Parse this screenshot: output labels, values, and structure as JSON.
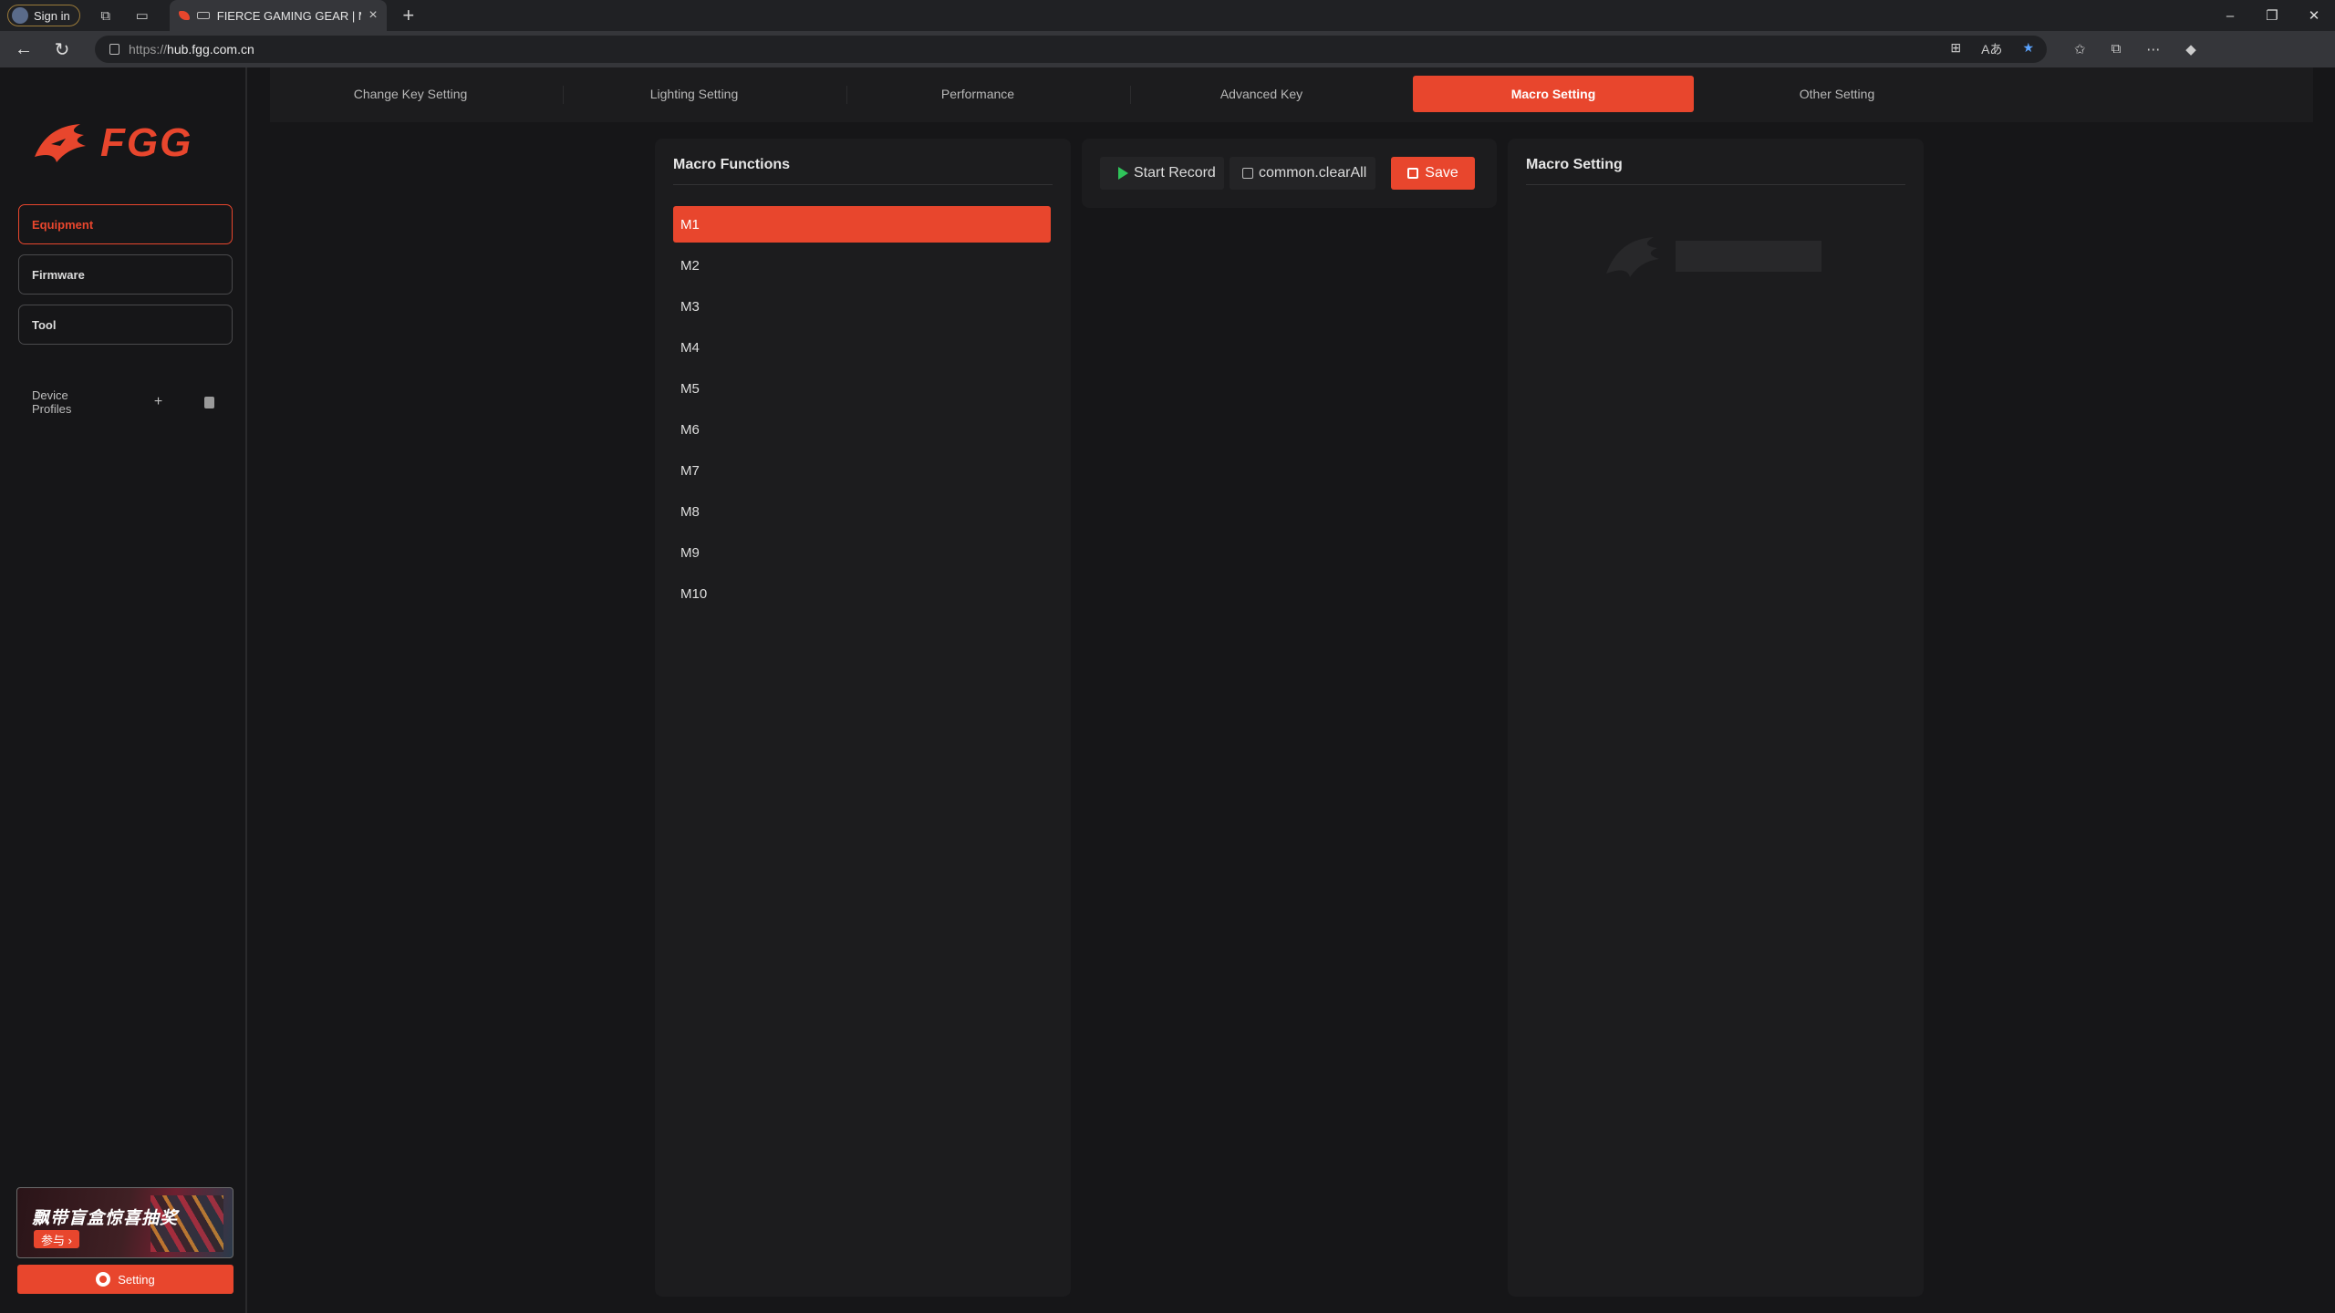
{
  "browser": {
    "signin_label": "Sign in",
    "tab_title": "FIERCE GAMING GEAR | MA...",
    "url_protocol": "https://",
    "url_host": "hub.fgg.com.cn"
  },
  "brand": {
    "logo_text": "FGG",
    "accent_color": "#e8462d"
  },
  "sidebar": {
    "items": [
      {
        "label": "Equipment",
        "active": true
      },
      {
        "label": "Firmware",
        "active": false
      },
      {
        "label": "Tool",
        "active": false
      }
    ],
    "profiles_label": "Device Profiles",
    "promo_title": "飘带盲盒惊喜抽奖",
    "promo_button": "参与 ›",
    "setting_label": "Setting"
  },
  "tabs": [
    {
      "label": "Change Key Setting",
      "active": false
    },
    {
      "label": "Lighting Setting",
      "active": false
    },
    {
      "label": "Performance",
      "active": false
    },
    {
      "label": "Advanced Key",
      "active": false
    },
    {
      "label": "Macro Setting",
      "active": true
    },
    {
      "label": "Other Setting",
      "active": false
    }
  ],
  "macro_functions": {
    "title": "Macro Functions",
    "items": [
      "M1",
      "M2",
      "M3",
      "M4",
      "M5",
      "M6",
      "M7",
      "M8",
      "M9",
      "M10"
    ],
    "selected": "M1"
  },
  "recorder": {
    "start_label": "Start Record",
    "clear_label": "common.clearAll",
    "save_label": "Save"
  },
  "macro_setting": {
    "title": "Macro Setting"
  }
}
